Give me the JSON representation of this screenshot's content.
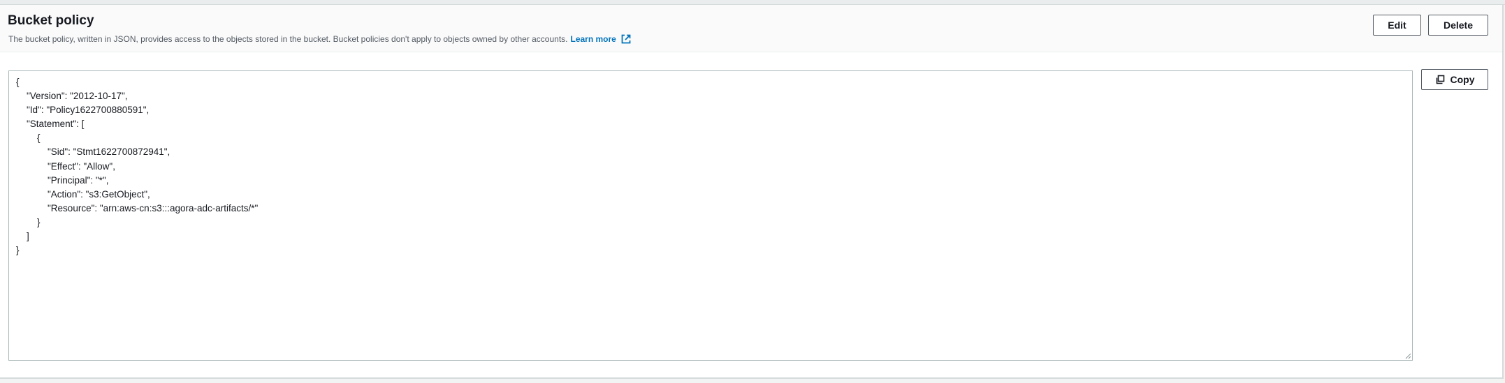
{
  "header": {
    "title": "Bucket policy",
    "description": "The bucket policy, written in JSON, provides access to the objects stored in the bucket. Bucket policies don't apply to objects owned by other accounts.",
    "learn_more_label": "Learn more",
    "learn_more_icon": "external-link-icon"
  },
  "actions": {
    "edit_label": "Edit",
    "delete_label": "Delete",
    "copy_label": "Copy",
    "copy_icon": "copy-icon"
  },
  "policy": {
    "lines": [
      "{",
      "    \"Version\": \"2012-10-17\",",
      "    \"Id\": \"Policy1622700880591\",",
      "    \"Statement\": [",
      "        {",
      "            \"Sid\": \"Stmt1622700872941\",",
      "            \"Effect\": \"Allow\",",
      "            \"Principal\": \"*\",",
      "            \"Action\": \"s3:GetObject\",",
      "            \"Resource\": \"arn:aws-cn:s3:::agora-adc-artifacts/*\"",
      "        }",
      "    ]",
      "}"
    ]
  },
  "colors": {
    "link": "#0073bb",
    "text": "#16191f",
    "muted": "#545b64"
  }
}
